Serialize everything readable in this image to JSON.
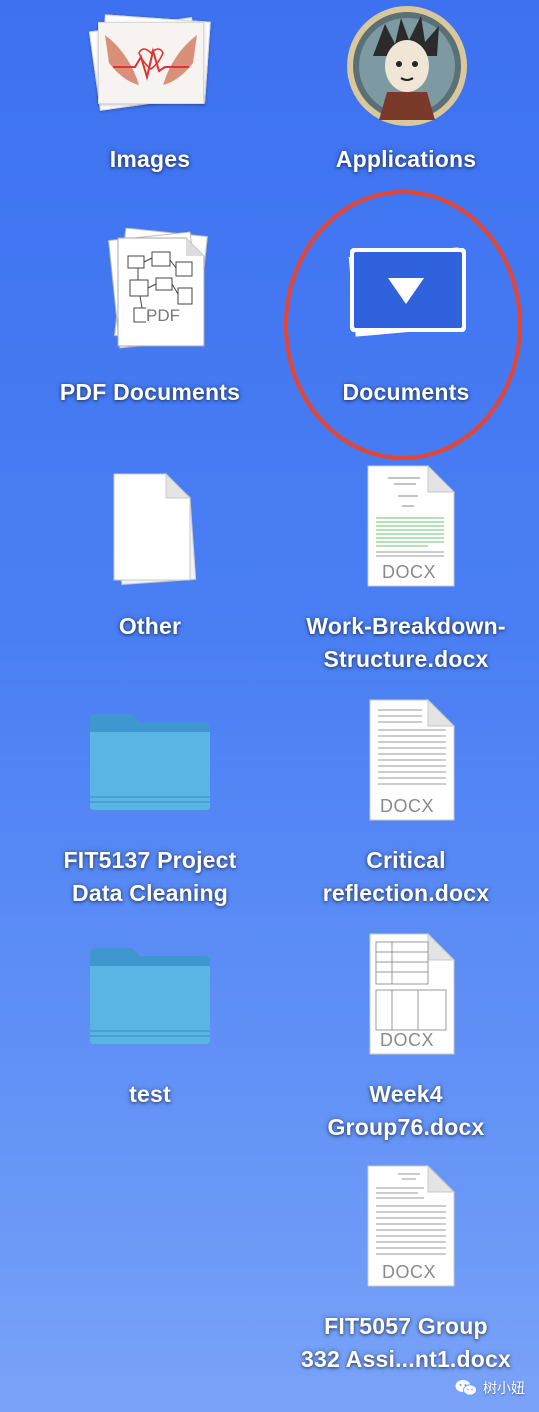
{
  "items": {
    "images": {
      "label": "Images",
      "icon": "photo-stack-icon"
    },
    "applications": {
      "label": "Applications",
      "icon": "app-avatar-icon"
    },
    "pdf_documents": {
      "label": "PDF Documents",
      "icon": "pdf-stack-icon",
      "badge": "PDF"
    },
    "documents": {
      "label": "Documents",
      "icon": "documents-stack-icon"
    },
    "other": {
      "label": "Other",
      "icon": "blank-document-icon"
    },
    "work_breakdown": {
      "line1": "Work-Breakdown-",
      "line2": "Structure.docx",
      "badge": "DOCX"
    },
    "fit5137": {
      "line1": "FIT5137 Project",
      "line2": "Data Cleaning",
      "icon": "folder-icon"
    },
    "critical": {
      "line1": "Critical",
      "line2": "reflection.docx",
      "badge": "DOCX"
    },
    "test": {
      "label": "test",
      "icon": "folder-icon"
    },
    "week4": {
      "line1": "Week4",
      "line2": "Group76.docx",
      "badge": "DOCX"
    },
    "fit5057": {
      "line1": "FIT5057 Group",
      "line2": "332 Assi...nt1.docx",
      "badge": "DOCX"
    }
  },
  "annotation": {
    "color": "#e8442e",
    "target": "Documents"
  },
  "watermark": {
    "text": "树小妞"
  },
  "colors": {
    "background_top": "#3d71f0",
    "background_bottom": "#7aa3f8",
    "folder": "#5ab4e4",
    "documents_blue": "#3366dd"
  }
}
